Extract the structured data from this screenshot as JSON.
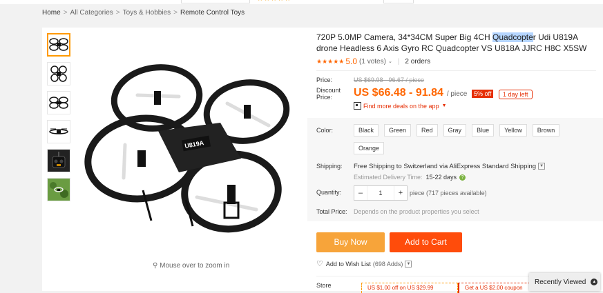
{
  "breadcrumb": {
    "home": "Home",
    "sep": ">",
    "all_categories": "All Categories",
    "toys": "Toys & Hobbies",
    "current": "Remote Control Toys"
  },
  "gallery": {
    "zoom_hint": "Mouse over to zoom in",
    "thumbnails": [
      "drone-thumb-1",
      "drone-thumb-2",
      "drone-thumb-3",
      "drone-thumb-4",
      "remote-thumb",
      "outdoor-thumb"
    ]
  },
  "product": {
    "title_before": "720P 5.0MP Camera, 34*34CM Super Big 4CH ",
    "title_highlight": "Quadcopte",
    "title_after": "r Udi U819A drone Headless 6 Axis Gyro RC Quadcopter VS U818A JJRC H8C X5SW",
    "stars": "★★★★★",
    "rating": "5.0",
    "votes": "(1 votes)",
    "orders": "2 orders"
  },
  "price": {
    "price_label": "Price:",
    "original": "US $69.98 - 96.67 / piece",
    "discount_label": "Discount Price:",
    "discounted": "US $66.48 - 91.84",
    "per": "/ piece",
    "off_badge": "5% off",
    "days_left": "1 day left",
    "deals_link": "Find more deals on the app"
  },
  "options": {
    "color_label": "Color:",
    "colors": [
      "Black",
      "Green",
      "Red",
      "Gray",
      "Blue",
      "Yellow",
      "Brown",
      "Orange"
    ],
    "shipping_label": "Shipping:",
    "shipping_prefix": "Free Shipping to ",
    "shipping_country": "Switzerland",
    "shipping_suffix": " via AliExpress Standard Shipping",
    "delivery_label": "Estimated Delivery Time:",
    "delivery_days": "15-22 days",
    "quantity_label": "Quantity:",
    "quantity_value": "1",
    "quantity_note": "piece (717 pieces available)",
    "total_label": "Total Price:",
    "total_note": "Depends on the product properties you select"
  },
  "actions": {
    "buy_now": "Buy Now",
    "add_to_cart": "Add to Cart",
    "wishlist": "Add to Wish List",
    "wish_adds": "(698 Adds)"
  },
  "store": {
    "label": "Store",
    "coupon1": "US $1.00 off on US $29.99",
    "coupon2": "Get a US $2.00 coupon"
  },
  "recently_viewed": "Recently Viewed",
  "colors_theme": {
    "accent": "#ff6600",
    "buy": "#f7a43a",
    "cart": "#ff4c0b",
    "badge": "#e62e04"
  }
}
